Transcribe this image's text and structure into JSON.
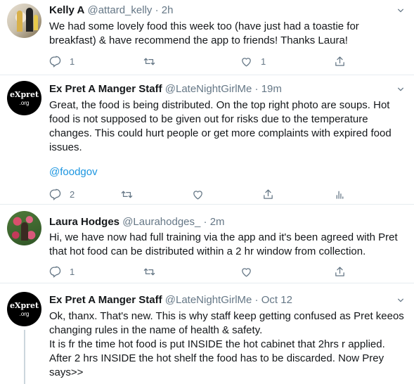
{
  "tweets": [
    {
      "name": "Kelly A",
      "handle": "@attard_kelly",
      "dot": "·",
      "time": "2h",
      "text": "We had some lovely food this week too (have just had a toastie for breakfast) & have recommend the app to friends! Thanks Laura!",
      "reply_count": "1",
      "retweet_count": "",
      "like_count": "1"
    },
    {
      "name": "Ex Pret A Manger Staff",
      "handle": "@LateNightGirlMe",
      "dot": "·",
      "time": "19m",
      "text": "Great, the food is being distributed. On the top right photo are soups. Hot food is not supposed to be given out for risks due to the temperature changes. This could hurt people or get more complaints with expired food issues.",
      "mention": "@foodgov",
      "reply_count": "2",
      "retweet_count": "",
      "like_count": "",
      "avatar_text": "eXpret",
      "avatar_sub": ".org"
    },
    {
      "name": "Laura Hodges",
      "handle": "@Laurahodges_",
      "dot": "·",
      "time": "2m",
      "text": "Hi, we have now had full training via the app and it's been agreed with Pret that hot food can be distributed within a 2 hr window from collection.",
      "reply_count": "1",
      "retweet_count": "",
      "like_count": ""
    },
    {
      "name": "Ex Pret A Manger Staff",
      "handle": "@LateNightGirlMe",
      "dot": "·",
      "time": "Oct 12",
      "text": "Ok, thanx. That's new. This is why staff keep getting confused as Pret keeos changing rules in the name of health & safety.\nIt is fr the time hot food is put INSIDE the hot cabinet that 2hrs r applied.\nAfter 2 hrs INSIDE the hot shelf the food has to be discarded. Now Prey says>>",
      "avatar_text": "eXpret",
      "avatar_sub": ".org"
    }
  ],
  "icons": {
    "reply": "reply-icon",
    "retweet": "retweet-icon",
    "like": "heart-icon",
    "share": "share-icon",
    "analytics": "analytics-icon",
    "more": "chevron-down-icon"
  },
  "colors": {
    "link": "#1b95e0",
    "muted": "#657786",
    "divider": "#e6ecf0"
  }
}
